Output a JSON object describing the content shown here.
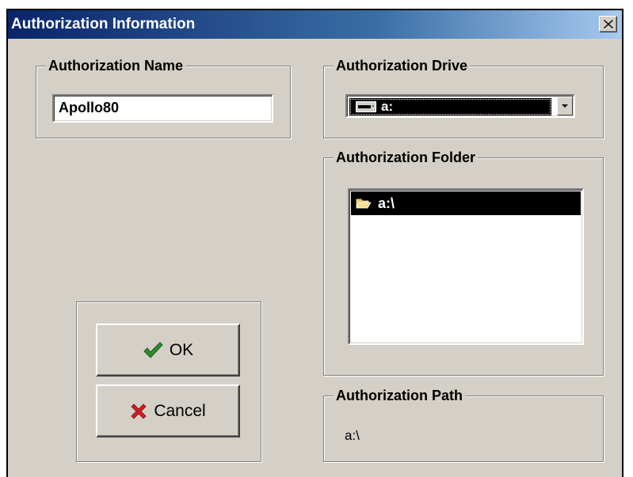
{
  "window": {
    "title": "Authorization Information",
    "close_icon": "close-icon"
  },
  "name_group": {
    "legend": "Authorization Name",
    "value": "Apollo80"
  },
  "drive_group": {
    "legend": "Authorization Drive",
    "selected": "a:",
    "icon": "floppy-drive-icon"
  },
  "folder_group": {
    "legend": "Authorization Folder",
    "items": [
      {
        "label": "a:\\",
        "icon": "open-folder-icon",
        "selected": true
      }
    ]
  },
  "path_group": {
    "legend": "Authorization Path",
    "value": "a:\\"
  },
  "buttons": {
    "ok_label": "OK",
    "cancel_label": "Cancel"
  },
  "colors": {
    "dialog_bg": "#d4d0c8",
    "titlebar_start": "#0a246a",
    "selection": "#000000",
    "ok_check": "#2e8b2e",
    "cancel_x": "#cc1f1f",
    "folder": "#e8c84a"
  }
}
